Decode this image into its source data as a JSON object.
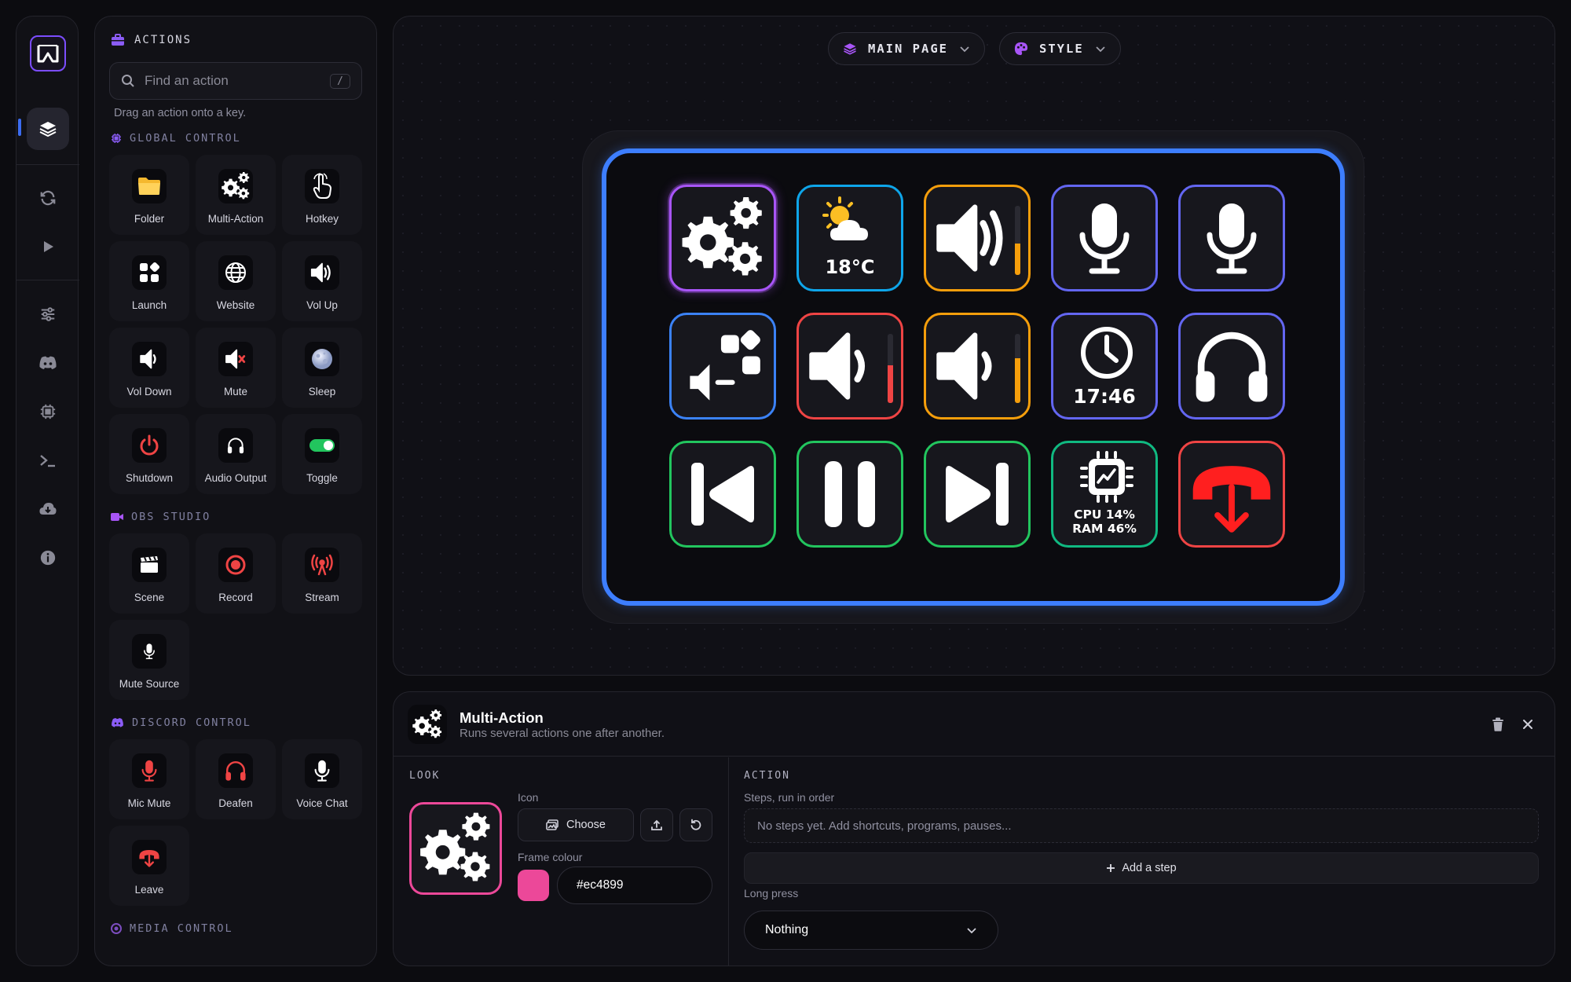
{
  "actions_panel": {
    "title": "ACTIONS",
    "search_placeholder": "Find an action",
    "search_shortcut": "/",
    "hint": "Drag an action onto a key.",
    "sections": [
      {
        "title": "GLOBAL CONTROL",
        "items": [
          "Folder",
          "Multi-Action",
          "Hotkey",
          "Launch",
          "Website",
          "Vol Up",
          "Vol Down",
          "Mute",
          "Sleep",
          "Shutdown",
          "Audio Output",
          "Toggle"
        ]
      },
      {
        "title": "OBS STUDIO",
        "items": [
          "Scene",
          "Record",
          "Stream",
          "Mute Source"
        ]
      },
      {
        "title": "DISCORD CONTROL",
        "items": [
          "Mic Mute",
          "Deafen",
          "Voice Chat",
          "Leave"
        ]
      },
      {
        "title": "MEDIA CONTROL",
        "items": []
      }
    ]
  },
  "toolbar": {
    "page_label": "MAIN PAGE",
    "style_label": "STYLE"
  },
  "deck": {
    "keys": [
      {
        "icon": "gears-icon",
        "frame": "#a855f7"
      },
      {
        "icon": "weather-icon",
        "frame": "#0ea5e9",
        "text": "18°C"
      },
      {
        "icon": "volume-up-icon",
        "frame": "#f59e0b",
        "level": 0.45,
        "level_color": "#f59e0b"
      },
      {
        "icon": "microphone-icon",
        "frame": "#6366f1"
      },
      {
        "icon": "microphone-icon",
        "frame": "#6366f1"
      },
      {
        "icon": "app-volume-icon",
        "frame": "#3b82f6"
      },
      {
        "icon": "volume-icon",
        "frame": "#ef4444",
        "level": 0.55,
        "level_color": "#ef4444"
      },
      {
        "icon": "volume-down-icon",
        "frame": "#f59e0b",
        "level": 0.65,
        "level_color": "#f59e0b"
      },
      {
        "icon": "clock-icon",
        "frame": "#6366f1",
        "text": "17:46"
      },
      {
        "icon": "headphones-icon",
        "frame": "#6366f1"
      },
      {
        "icon": "previous-track-icon",
        "frame": "#22c55e"
      },
      {
        "icon": "pause-icon",
        "frame": "#22c55e"
      },
      {
        "icon": "next-track-icon",
        "frame": "#22c55e"
      },
      {
        "icon": "cpu-monitor-icon",
        "frame": "#10b981",
        "text_cpu": "CPU 14%",
        "text_ram": "RAM 46%"
      },
      {
        "icon": "leave-call-icon",
        "frame": "#ef4444"
      }
    ]
  },
  "editor": {
    "title": "Multi-Action",
    "subtitle": "Runs several actions one after another.",
    "look_label": "LOOK",
    "icon_label": "Icon",
    "choose_label": "Choose",
    "frame_colour_label": "Frame colour",
    "frame_colour": "#ec4899",
    "action_label": "ACTION",
    "steps_label": "Steps, run in order",
    "steps_empty": "No steps yet. Add shortcuts, programs, pauses...",
    "add_step_label": "Add a step",
    "long_press_label": "Long press",
    "long_press_value": "Nothing"
  }
}
